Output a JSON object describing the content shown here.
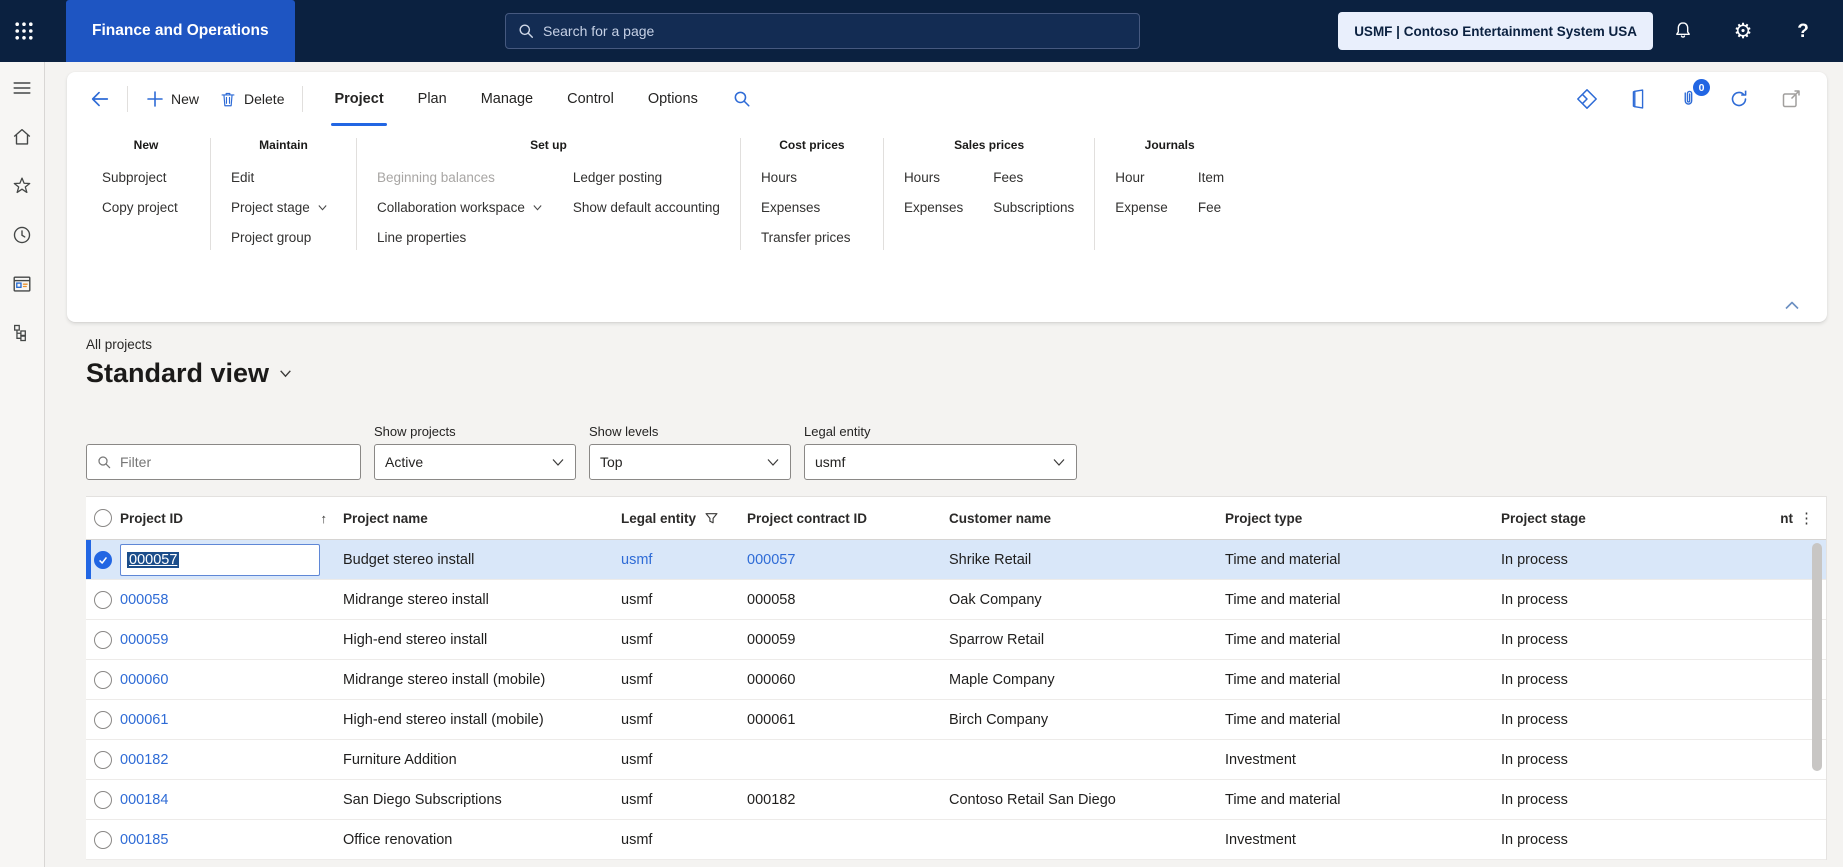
{
  "colors": {
    "topbar_bg": "#0B2140",
    "brand_tab": "#1E55C2",
    "accent": "#2266E3",
    "selected_row_bg": "#D9E7F9",
    "link": "#2E6BD6"
  },
  "icons": {
    "sort_ascending": "↑",
    "kebab": "⋮",
    "gear": "⚙",
    "help": "?"
  },
  "topbar": {
    "app_title": "Finance and Operations",
    "search_placeholder": "Search for a page",
    "company": "USMF | Contoso Entertainment System USA"
  },
  "action_bar": {
    "new_label": "New",
    "delete_label": "Delete",
    "attachments_badge": "0",
    "tabs": [
      {
        "label": "Project",
        "active": true
      },
      {
        "label": "Plan",
        "active": false
      },
      {
        "label": "Manage",
        "active": false
      },
      {
        "label": "Control",
        "active": false
      },
      {
        "label": "Options",
        "active": false
      }
    ]
  },
  "ribbon": {
    "groups": [
      {
        "title": "New",
        "cols": [
          [
            {
              "label": "Subproject"
            },
            {
              "label": "Copy project"
            }
          ]
        ]
      },
      {
        "title": "Maintain",
        "cols": [
          [
            {
              "label": "Edit"
            },
            {
              "label": "Project stage",
              "dropdown": true
            },
            {
              "label": "Project group"
            }
          ]
        ]
      },
      {
        "title": "Set up",
        "cols": [
          [
            {
              "label": "Beginning balances",
              "disabled": true
            },
            {
              "label": "Collaboration workspace",
              "dropdown": true
            },
            {
              "label": "Line properties"
            }
          ],
          [
            {
              "label": "Ledger posting"
            },
            {
              "label": "Show default accounting"
            }
          ]
        ]
      },
      {
        "title": "Cost prices",
        "cols": [
          [
            {
              "label": "Hours"
            },
            {
              "label": "Expenses"
            },
            {
              "label": "Transfer prices"
            }
          ]
        ]
      },
      {
        "title": "Sales prices",
        "cols": [
          [
            {
              "label": "Hours"
            },
            {
              "label": "Expenses"
            }
          ],
          [
            {
              "label": "Fees"
            },
            {
              "label": "Subscriptions"
            }
          ]
        ]
      },
      {
        "title": "Journals",
        "cols": [
          [
            {
              "label": "Hour"
            },
            {
              "label": "Expense"
            }
          ],
          [
            {
              "label": "Item"
            },
            {
              "label": "Fee"
            }
          ]
        ]
      }
    ]
  },
  "page": {
    "breadcrumb": "All projects",
    "view_title": "Standard view"
  },
  "filters": {
    "filter_placeholder": "Filter",
    "selects": [
      {
        "label": "Show projects",
        "value": "Active"
      },
      {
        "label": "Show levels",
        "value": "Top"
      },
      {
        "label": "Legal entity",
        "value": "usmf"
      }
    ]
  },
  "grid": {
    "columns": [
      "Project ID",
      "Project name",
      "Legal entity",
      "Project contract ID",
      "Customer name",
      "Project type",
      "Project stage",
      "Int"
    ],
    "rows": [
      {
        "project_id": "000057",
        "project_name": "Budget stereo install",
        "legal_entity": "usmf",
        "contract_id": "000057",
        "customer": "Shrike Retail",
        "type": "Time and material",
        "stage": "In process",
        "selected": true
      },
      {
        "project_id": "000058",
        "project_name": "Midrange stereo install",
        "legal_entity": "usmf",
        "contract_id": "000058",
        "customer": "Oak Company",
        "type": "Time and material",
        "stage": "In process",
        "selected": false
      },
      {
        "project_id": "000059",
        "project_name": "High-end stereo install",
        "legal_entity": "usmf",
        "contract_id": "000059",
        "customer": "Sparrow Retail",
        "type": "Time and material",
        "stage": "In process",
        "selected": false
      },
      {
        "project_id": "000060",
        "project_name": "Midrange stereo install (mobile)",
        "legal_entity": "usmf",
        "contract_id": "000060",
        "customer": "Maple Company",
        "type": "Time and material",
        "stage": "In process",
        "selected": false
      },
      {
        "project_id": "000061",
        "project_name": "High-end stereo install (mobile)",
        "legal_entity": "usmf",
        "contract_id": "000061",
        "customer": "Birch Company",
        "type": "Time and material",
        "stage": "In process",
        "selected": false
      },
      {
        "project_id": "000182",
        "project_name": "Furniture Addition",
        "legal_entity": "usmf",
        "contract_id": "",
        "customer": "",
        "type": "Investment",
        "stage": "In process",
        "selected": false
      },
      {
        "project_id": "000184",
        "project_name": "San Diego Subscriptions",
        "legal_entity": "usmf",
        "contract_id": "000182",
        "customer": "Contoso Retail San Diego",
        "type": "Time and material",
        "stage": "In process",
        "selected": false
      },
      {
        "project_id": "000185",
        "project_name": "Office renovation",
        "legal_entity": "usmf",
        "contract_id": "",
        "customer": "",
        "type": "Investment",
        "stage": "In process",
        "selected": false
      }
    ]
  }
}
